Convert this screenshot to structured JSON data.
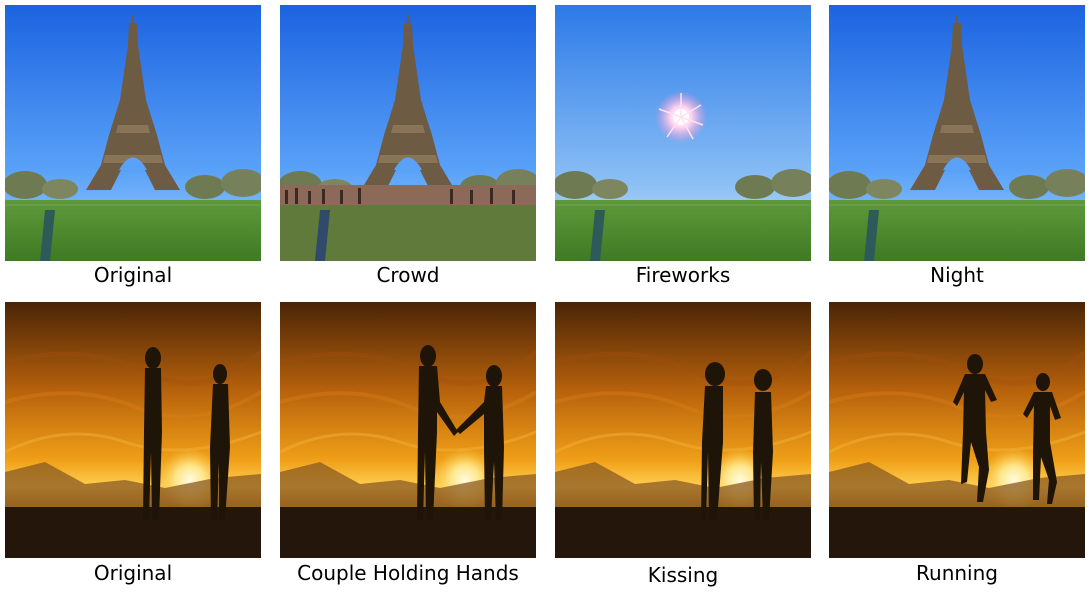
{
  "rows": [
    {
      "name": "eiffel",
      "captions": [
        "Original",
        "Crowd",
        "Fireworks",
        "Night"
      ]
    },
    {
      "name": "sunset",
      "captions": [
        "Original",
        "Couple Holding Hands",
        "Kissing",
        "Running"
      ]
    }
  ],
  "colors": {
    "sky_top": "#1f6fe6",
    "sky_bottom": "#8fc3ff",
    "grass": "#4f8f2f",
    "tower": "#6b5a44",
    "sunset_top": "#3a1d05",
    "sunset_mid": "#e08a12",
    "sunset_glow": "#ffd24a",
    "silhouette": "#1e1408"
  }
}
